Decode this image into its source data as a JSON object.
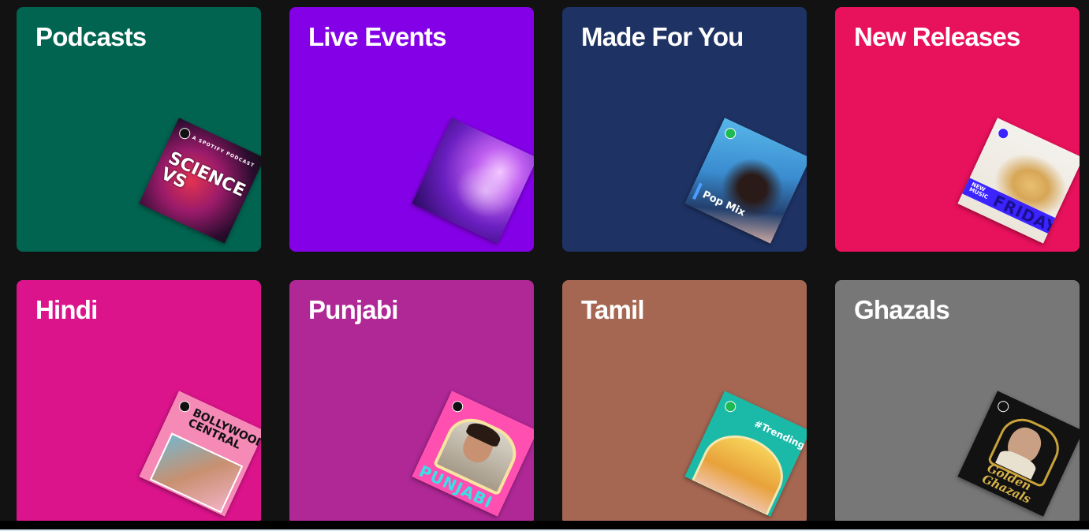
{
  "categories": [
    {
      "title": "Podcasts",
      "bg": "#006450",
      "art": {
        "name": "science-vs-cover",
        "small": "A SPOTIFY PODCAST",
        "big": "SCIENCE VS"
      }
    },
    {
      "title": "Live Events",
      "bg": "#8400e7",
      "art": {
        "name": "live-concert-photo"
      }
    },
    {
      "title": "Made For You",
      "bg": "#1e3264",
      "art": {
        "name": "pop-mix-cover",
        "label": "Pop Mix"
      }
    },
    {
      "title": "New Releases",
      "bg": "#e8115b",
      "art": {
        "name": "new-music-friday-cover",
        "label": "NEW MUSIC",
        "big": "FRIDAY"
      }
    },
    {
      "title": "Hindi",
      "bg": "#dc148c",
      "art": {
        "name": "bollywood-central-cover",
        "big": "BOLLYWOOD CENTRAL"
      }
    },
    {
      "title": "Punjabi",
      "bg": "#af2896",
      "art": {
        "name": "punjabi-cover",
        "big": "PUNJABI"
      }
    },
    {
      "title": "Tamil",
      "bg": "#a56752",
      "art": {
        "name": "trending-tamil-cover",
        "label": "#Trending"
      }
    },
    {
      "title": "Ghazals",
      "bg": "#777777",
      "art": {
        "name": "golden-ghazals-cover",
        "big": "Golden Ghazals"
      }
    }
  ]
}
